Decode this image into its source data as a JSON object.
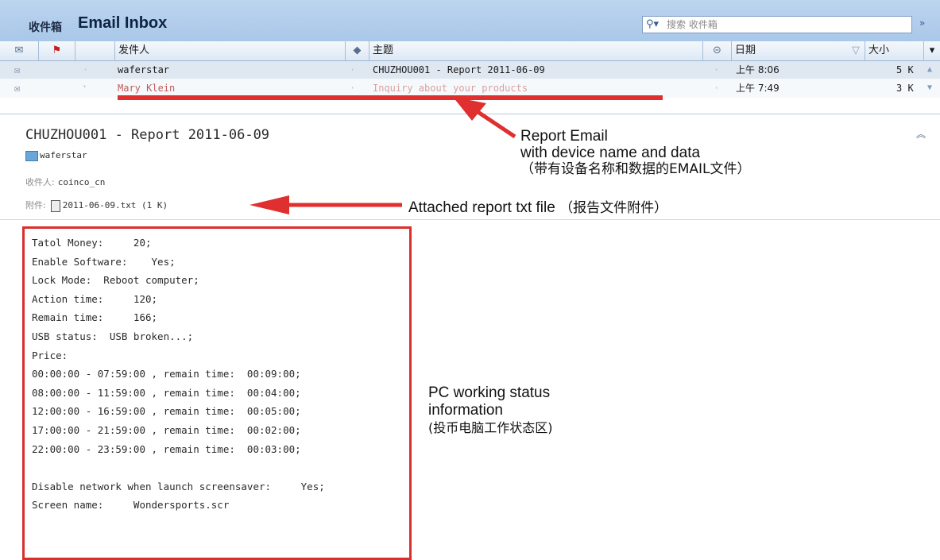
{
  "header": {
    "folder_label": "收件箱",
    "title": "Email Inbox",
    "search_placeholder": "搜索 收件箱"
  },
  "columns": {
    "from": "发件人",
    "subject": "主题",
    "date": "日期",
    "size": "大小"
  },
  "messages": [
    {
      "from": "waferstar",
      "subject": "CHUZHOU001 - Report  2011-06-09",
      "date": "上午 8:06",
      "size": "5 K"
    },
    {
      "from": "Mary Klein",
      "subject": "Inquiry about your products",
      "date": "上午 7:49",
      "size": "3 K"
    }
  ],
  "preview": {
    "subject": "CHUZHOU001 - Report  2011-06-09",
    "sender": "waferstar",
    "recipient_label": "收件人:",
    "recipient": "coinco_cn",
    "attachment_label": "附件:",
    "attachment": "2011-06-09.txt (1 K)",
    "body_lines": [
      "Tatol Money:     20;",
      "Enable Software:    Yes;",
      "Lock Mode:  Reboot computer;",
      "Action time:     120;",
      "Remain time:     166;",
      "USB status:  USB broken...;",
      "Price:",
      "00:00:00 - 07:59:00 , remain time:  00:09:00;",
      "08:00:00 - 11:59:00 , remain time:  00:04:00;",
      "12:00:00 - 16:59:00 , remain time:  00:05:00;",
      "17:00:00 - 21:59:00 , remain time:  00:02:00;",
      "22:00:00 - 23:59:00 , remain time:  00:03:00;",
      "",
      "Disable network when launch screensaver:     Yes;",
      "Screen name:     Wondersports.scr"
    ]
  },
  "annotations": {
    "report_email_line1": "Report Email",
    "report_email_line2": "with device name and data",
    "report_email_cn": "（带有设备名称和数据的EMAIL文件）",
    "attachment_note": "Attached report txt file",
    "attachment_note_cn": "（报告文件附件）",
    "status_line1": "PC working status",
    "status_line2": "information",
    "status_cn": "(投币电脑工作状态区)"
  },
  "colors": {
    "accent": "#a9c7e8",
    "annotation": "#e02f2f"
  }
}
